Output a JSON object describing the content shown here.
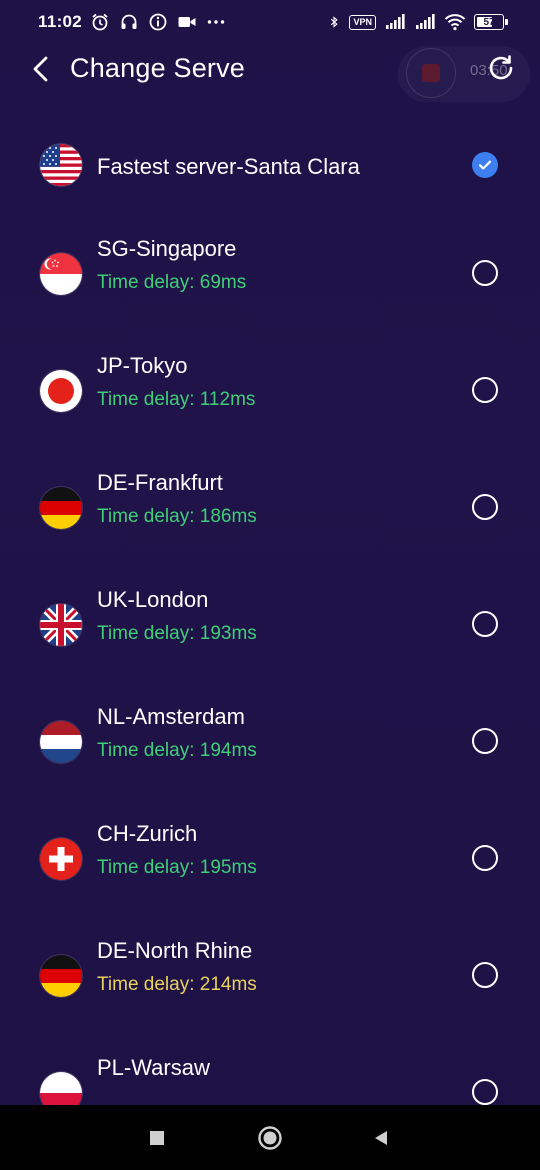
{
  "status_bar": {
    "time": "11:02",
    "vpn_label": "VPN",
    "battery_level": "57",
    "left_icons": [
      "alarm-icon",
      "headset-icon",
      "info-icon",
      "video-camera-icon",
      "more-dots-icon"
    ],
    "right_icons": [
      "bluetooth-icon",
      "vpn-icon",
      "signal-icon",
      "signal-icon",
      "wifi-icon",
      "battery-icon"
    ]
  },
  "header": {
    "title": "Change Serve",
    "record_time": "03:50"
  },
  "colors": {
    "background": "#1e1247",
    "delay_good": "#3fcf76",
    "delay_medium": "#e9d25a",
    "selected": "#3d7ff0"
  },
  "servers": [
    {
      "name": "Fastest server-Santa Clara",
      "flag": "us-flag-icon",
      "selected": true
    },
    {
      "name": "SG-Singapore",
      "delay": "Time delay: 69ms",
      "flag": "sg-flag-icon",
      "selected": false
    },
    {
      "name": "JP-Tokyo",
      "delay": "Time delay: 112ms",
      "flag": "jp-flag-icon",
      "selected": false
    },
    {
      "name": "DE-Frankfurt",
      "delay": "Time delay: 186ms",
      "flag": "de-flag-icon",
      "selected": false
    },
    {
      "name": "UK-London",
      "delay": "Time delay: 193ms",
      "flag": "uk-flag-icon",
      "selected": false
    },
    {
      "name": "NL-Amsterdam",
      "delay": "Time delay: 194ms",
      "flag": "nl-flag-icon",
      "selected": false
    },
    {
      "name": "CH-Zurich",
      "delay": "Time delay: 195ms",
      "flag": "ch-flag-icon",
      "selected": false
    },
    {
      "name": "DE-North Rhine",
      "delay": "Time delay: 214ms",
      "flag": "de-flag-icon",
      "selected": false
    },
    {
      "name": "PL-Warsaw",
      "flag": "pl-flag-icon",
      "selected": false
    }
  ],
  "nav_bar": {
    "icons": [
      "recents-square-icon",
      "home-circle-icon",
      "back-triangle-icon"
    ]
  }
}
